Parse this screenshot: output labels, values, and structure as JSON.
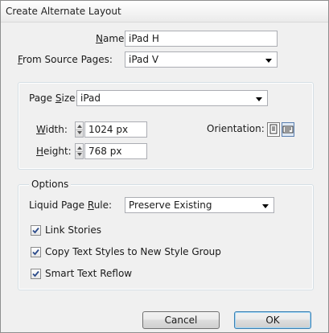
{
  "dialog": {
    "title": "Create Alternate Layout"
  },
  "name": {
    "label_pre": "",
    "label_u": "N",
    "label_post": "ame:",
    "value": "iPad H"
  },
  "source": {
    "label_pre": "",
    "label_u": "F",
    "label_post": "rom Source Pages:",
    "value": "iPad V"
  },
  "page_size": {
    "label_pre": "Page ",
    "label_u": "S",
    "label_post": "ize:",
    "value": "iPad"
  },
  "width": {
    "label_pre": "",
    "label_u": "W",
    "label_post": "idth:",
    "value": "1024 px"
  },
  "height": {
    "label_pre": "",
    "label_u": "H",
    "label_post": "eight:",
    "value": "768 px"
  },
  "orientation": {
    "label": "Orientation:",
    "selected": "landscape"
  },
  "options": {
    "legend": "Options",
    "liquid_rule": {
      "label_pre": "Liquid Page ",
      "label_u": "R",
      "label_post": "ule:",
      "value": "Preserve Existing"
    },
    "link_stories": {
      "label": "Link Stories",
      "checked": true
    },
    "copy_styles": {
      "label": "Copy Text Styles to New Style Group",
      "checked": true
    },
    "smart_reflow": {
      "label": "Smart Text Reflow",
      "checked": true
    }
  },
  "buttons": {
    "cancel": "Cancel",
    "ok": "OK"
  }
}
